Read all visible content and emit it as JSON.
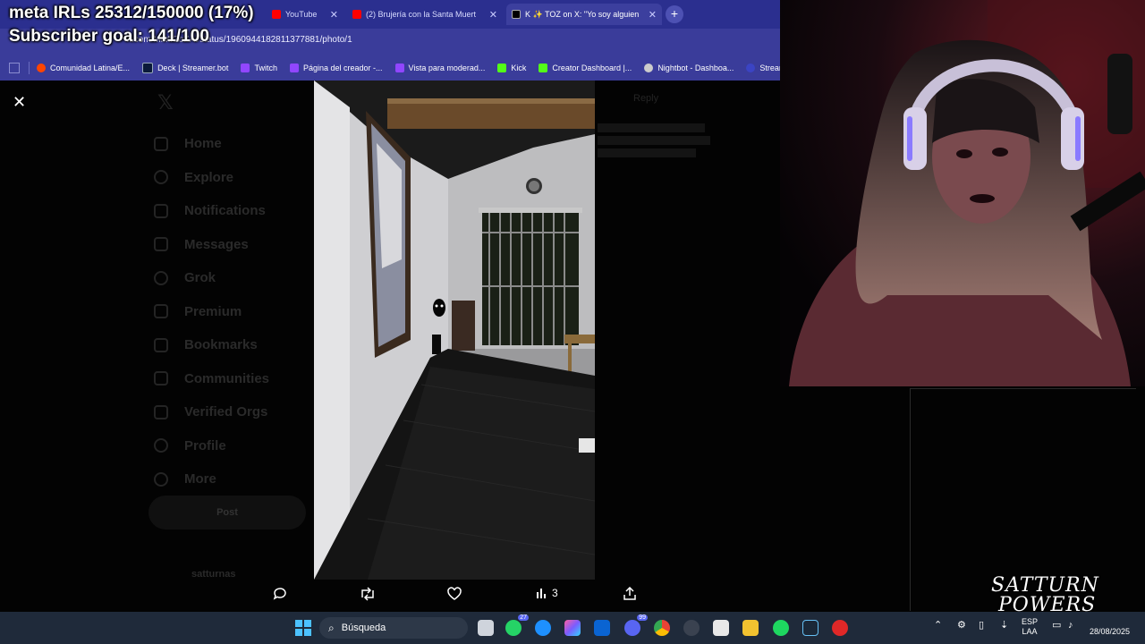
{
  "overlay": {
    "goal_line": "meta IRLs 25312/150000 (17%)",
    "subscriber_line": "Subscriber goal: 141/100"
  },
  "browser": {
    "tabs": [
      {
        "label": "YouTube",
        "favicon": "youtube-icon",
        "active": false
      },
      {
        "label": "(2) Brujería con la Santa Muert",
        "favicon": "youtube-icon",
        "active": false
      },
      {
        "label": "K ✨ TOZ on X: \"Yo soy alguien",
        "favicon": "x-icon",
        "active": true
      }
    ],
    "url": "x.com/MiMiCoZAi/status/1960944182811377881/photo/1",
    "bookmarks": [
      {
        "label": "Comunidad Latina/E...",
        "icon": "reddit-icon",
        "color": "#ff4500"
      },
      {
        "label": "Deck | Streamer.bot",
        "icon": "streamerbot-icon",
        "color": "#0b1a3a"
      },
      {
        "label": "Twitch",
        "icon": "twitch-icon",
        "color": "#9146ff"
      },
      {
        "label": "Página del creador -...",
        "icon": "twitch-icon",
        "color": "#9146ff"
      },
      {
        "label": "Vista para moderad...",
        "icon": "twitch-icon",
        "color": "#9146ff"
      },
      {
        "label": "Kick",
        "icon": "kick-icon",
        "color": "#53fc18"
      },
      {
        "label": "Creator Dashboard |...",
        "icon": "kick-icon",
        "color": "#53fc18"
      },
      {
        "label": "Nightbot - Dashboa...",
        "icon": "nightbot-icon",
        "color": "#cccccc"
      },
      {
        "label": "Streami",
        "icon": "streamelements-icon",
        "color": "#3b44c4"
      }
    ]
  },
  "twitter": {
    "nav": [
      "Home",
      "Explore",
      "Notifications",
      "Messages",
      "Grok",
      "Premium",
      "Bookmarks",
      "Communities",
      "Verified Orgs",
      "Profile",
      "More"
    ],
    "post_label": "Post",
    "reply_label": "Reply",
    "profile_name": "satturnas",
    "actions": {
      "views": "3"
    }
  },
  "taskbar": {
    "search_label": "Búsqueda",
    "whatsapp_badge": "27",
    "discord_badge": "99",
    "lang_top": "ESP",
    "lang_bottom": "LAA",
    "date": "28/08/2025"
  },
  "branding": {
    "line1": "SATTURN",
    "line2": "POWERS"
  }
}
